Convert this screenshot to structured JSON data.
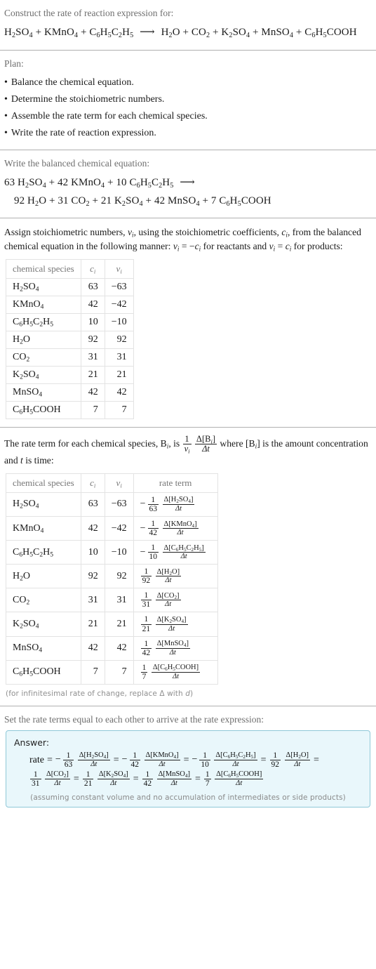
{
  "header": {
    "prompt": "Construct the rate of reaction expression for:",
    "reaction": {
      "reactants": [
        "H2SO4",
        "KMnO4",
        "C6H5C2H5"
      ],
      "products": [
        "H2O",
        "CO2",
        "K2SO4",
        "MnSO4",
        "C6H5COOH"
      ],
      "arrow": "⟶"
    }
  },
  "plan": {
    "title": "Plan:",
    "steps": [
      "Balance the chemical equation.",
      "Determine the stoichiometric numbers.",
      "Assemble the rate term for each chemical species.",
      "Write the rate of reaction expression."
    ]
  },
  "balanced": {
    "prompt": "Write the balanced chemical equation:",
    "left_line": "63 H2SO4 + 42 KMnO4 + 10 C6H5C2H5  ⟶",
    "right_line": "92 H2O + 31 CO2 + 21 K2SO4 + 42 MnSO4 + 7 C6H5COOH",
    "reactant_coeffs": [
      63,
      42,
      10
    ],
    "product_coeffs": [
      92,
      31,
      21,
      42,
      7
    ]
  },
  "stoich": {
    "prompt_part1": "Assign stoichiometric numbers, ",
    "prompt_v1": "νi",
    "prompt_part2": ", using the stoichiometric coefficients, ",
    "prompt_c1": "ci",
    "prompt_part3": ", from the balanced chemical equation in the following manner: ",
    "prompt_rule1": "νi = −ci",
    "prompt_part4": " for reactants and ",
    "prompt_rule2": "νi = ci",
    "prompt_part5": " for products:",
    "columns": [
      "chemical species",
      "ci",
      "νi"
    ],
    "rows": [
      {
        "species": "H2SO4",
        "c": "63",
        "v": "−63"
      },
      {
        "species": "KMnO4",
        "c": "42",
        "v": "−42"
      },
      {
        "species": "C6H5C2H5",
        "c": "10",
        "v": "−10"
      },
      {
        "species": "H2O",
        "c": "92",
        "v": "92"
      },
      {
        "species": "CO2",
        "c": "31",
        "v": "31"
      },
      {
        "species": "K2SO4",
        "c": "21",
        "v": "21"
      },
      {
        "species": "MnSO4",
        "c": "42",
        "v": "42"
      },
      {
        "species": "C6H5COOH",
        "c": "7",
        "v": "7"
      }
    ]
  },
  "rateterms": {
    "prompt_a": "The rate term for each chemical species, ",
    "prompt_b": "Bi",
    "prompt_c": ", is ",
    "prompt_d": " where ",
    "prompt_e": "[Bi]",
    "prompt_f": " is the amount concentration and ",
    "prompt_g": "t",
    "prompt_h": " is time:",
    "generic_frac_num": "1",
    "generic_frac_den": "νi",
    "generic_delta_num": "Δ[Bi]",
    "generic_delta_den": "Δt",
    "columns": [
      "chemical species",
      "ci",
      "νi",
      "rate term"
    ],
    "rows": [
      {
        "species": "H2SO4",
        "c": "63",
        "v": "−63",
        "sign": "−",
        "denom": "63",
        "delta": "Δ[H2SO4]",
        "dt": "Δt"
      },
      {
        "species": "KMnO4",
        "c": "42",
        "v": "−42",
        "sign": "−",
        "denom": "42",
        "delta": "Δ[KMnO4]",
        "dt": "Δt"
      },
      {
        "species": "C6H5C2H5",
        "c": "10",
        "v": "−10",
        "sign": "−",
        "denom": "10",
        "delta": "Δ[C6H5C2H5]",
        "dt": "Δt"
      },
      {
        "species": "H2O",
        "c": "92",
        "v": "92",
        "sign": "",
        "denom": "92",
        "delta": "Δ[H2O]",
        "dt": "Δt"
      },
      {
        "species": "CO2",
        "c": "31",
        "v": "31",
        "sign": "",
        "denom": "31",
        "delta": "Δ[CO2]",
        "dt": "Δt"
      },
      {
        "species": "K2SO4",
        "c": "21",
        "v": "21",
        "sign": "",
        "denom": "21",
        "delta": "Δ[K2SO4]",
        "dt": "Δt"
      },
      {
        "species": "MnSO4",
        "c": "42",
        "v": "42",
        "sign": "",
        "denom": "42",
        "delta": "Δ[MnSO4]",
        "dt": "Δt"
      },
      {
        "species": "C6H5COOH",
        "c": "7",
        "v": "7",
        "sign": "",
        "denom": "7",
        "delta": "Δ[C6H5COOH]",
        "dt": "Δt"
      }
    ],
    "footnote": "(for infinitesimal rate of change, replace Δ with d)"
  },
  "final": {
    "prompt": "Set the rate terms equal to each other to arrive at the rate expression:",
    "answer_label": "Answer:",
    "rate_label": "rate",
    "terms": [
      {
        "sign": "−",
        "denom": "63",
        "delta": "Δ[H2SO4]",
        "dt": "Δt"
      },
      {
        "sign": "−",
        "denom": "42",
        "delta": "Δ[KMnO4]",
        "dt": "Δt"
      },
      {
        "sign": "−",
        "denom": "10",
        "delta": "Δ[C6H5C2H5]",
        "dt": "Δt"
      },
      {
        "sign": "",
        "denom": "92",
        "delta": "Δ[H2O]",
        "dt": "Δt"
      },
      {
        "sign": "",
        "denom": "31",
        "delta": "Δ[CO2]",
        "dt": "Δt"
      },
      {
        "sign": "",
        "denom": "21",
        "delta": "Δ[K2SO4]",
        "dt": "Δt"
      },
      {
        "sign": "",
        "denom": "42",
        "delta": "Δ[MnSO4]",
        "dt": "Δt"
      },
      {
        "sign": "",
        "denom": "7",
        "delta": "Δ[C6H5COOH]",
        "dt": "Δt"
      }
    ],
    "note": "(assuming constant volume and no accumulation of intermediates or side products)"
  },
  "colors": {
    "answer_bg": "#e9f7fb",
    "answer_border": "#8fc8d8",
    "rule": "#b0b0b0",
    "muted_text": "#6e6e6e",
    "table_border": "#e3e3e3"
  }
}
